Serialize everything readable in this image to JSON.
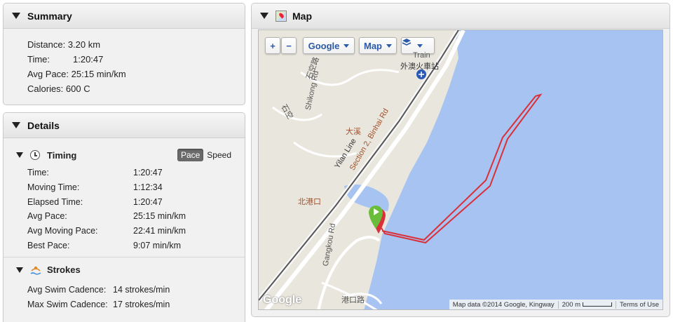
{
  "summary": {
    "title": "Summary",
    "rows": [
      {
        "label": "Distance:",
        "value": "3.20 km"
      },
      {
        "label": "Time:",
        "value": "1:20:47"
      },
      {
        "label": "Avg Pace:",
        "value": "25:15 min/km"
      },
      {
        "label": "Calories:",
        "value": "600 C"
      }
    ]
  },
  "details": {
    "title": "Details",
    "timing": {
      "title": "Timing",
      "toggle": {
        "selected": "Pace",
        "other": "Speed"
      },
      "rows": [
        {
          "label": "Time:",
          "value": "1:20:47"
        },
        {
          "label": "Moving Time:",
          "value": "1:12:34"
        },
        {
          "label": "Elapsed Time:",
          "value": "1:20:47"
        },
        {
          "label": "Avg Pace:",
          "value": "25:15 min/km"
        },
        {
          "label": "Avg Moving Pace:",
          "value": "22:41 min/km"
        },
        {
          "label": "Best Pace:",
          "value": "9:07 min/km"
        }
      ]
    },
    "strokes": {
      "title": "Strokes",
      "rows": [
        {
          "label": "Avg Swim Cadence:",
          "value": "14 strokes/min"
        },
        {
          "label": "Max Swim Cadence:",
          "value": "17 strokes/min"
        }
      ]
    }
  },
  "map": {
    "title": "Map",
    "controls": {
      "zoom_in": "+",
      "zoom_out": "−",
      "provider": "Google",
      "type": "Map"
    },
    "labels": {
      "train": "Train",
      "station": "外澳火車站",
      "road1": "Section 2, Binhai Rd",
      "road2": "Yilan Line",
      "road3": "Gangkou Rd",
      "road4": "Shikong Rd",
      "place1": "大溪",
      "place2": "北港口",
      "place3": "港口路",
      "place4": "石空路",
      "place5": "石空"
    },
    "attribution": {
      "data": "Map data ©2014 Google, Kingway",
      "scale": "200 m",
      "terms": "Terms of Use"
    },
    "logo": "Google",
    "colors": {
      "water": "#a7c3f2",
      "land": "#e9e6dd",
      "route": "#d9303a",
      "marker": "#6abd3a"
    }
  }
}
